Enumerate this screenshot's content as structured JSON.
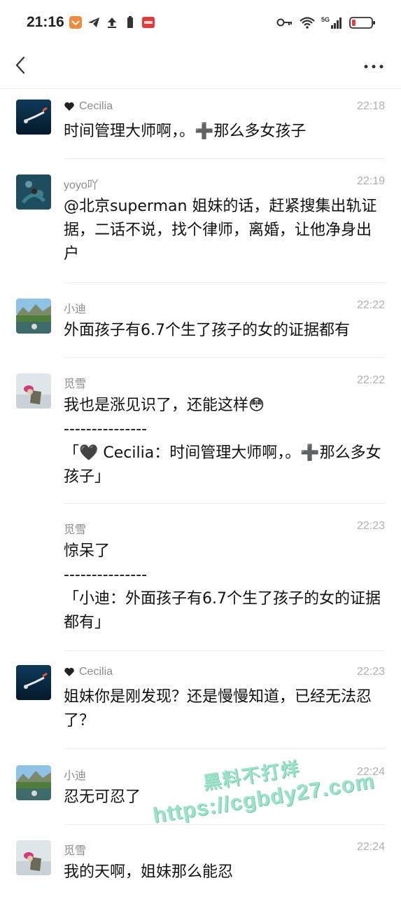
{
  "status": {
    "time": "21:16",
    "network": "5G"
  },
  "messages": [
    {
      "user": "Cecilia",
      "heart": true,
      "time": "22:18",
      "avatar": "diver",
      "text": "时间管理大师啊，。➕那么多女孩子"
    },
    {
      "user": "yoyo吖",
      "heart": false,
      "time": "22:19",
      "avatar": "underwater",
      "text": "@北京superman 姐妹的话，赶紧搜集出轨证据，二话不说，找个律师，离婚，让他净身出户"
    },
    {
      "user": "小迪",
      "heart": false,
      "time": "22:22",
      "avatar": "lake",
      "text": "外面孩子有6.7个生了孩子的女的证据都有"
    },
    {
      "user": "觅雪",
      "heart": false,
      "time": "22:22",
      "avatar": "girl",
      "text": "我也是涨见识了，还能这样😳",
      "quote_sep": "---------------",
      "quote": "「🖤 Cecilia：时间管理大师啊，。➕那么多女孩子」"
    },
    {
      "user": "觅雪",
      "heart": false,
      "time": "22:23",
      "avatar": "",
      "text": "惊呆了",
      "quote_sep": "---------------",
      "quote": "「小迪：外面孩子有6.7个生了孩子的女的证据都有」"
    },
    {
      "user": "Cecilia",
      "heart": true,
      "time": "22:23",
      "avatar": "diver",
      "text": "姐妹你是刚发现？还是慢慢知道，已经无法忍了？"
    },
    {
      "user": "小迪",
      "heart": false,
      "time": "22:24",
      "avatar": "lake",
      "text": "忍无可忍了"
    },
    {
      "user": "觅雪",
      "heart": false,
      "time": "22:24",
      "avatar": "girl",
      "text": "我的天啊，姐妹那么能忍"
    }
  ],
  "watermark": {
    "line1": "黑料不打烊",
    "line2": "https://cgbdy27.com"
  }
}
